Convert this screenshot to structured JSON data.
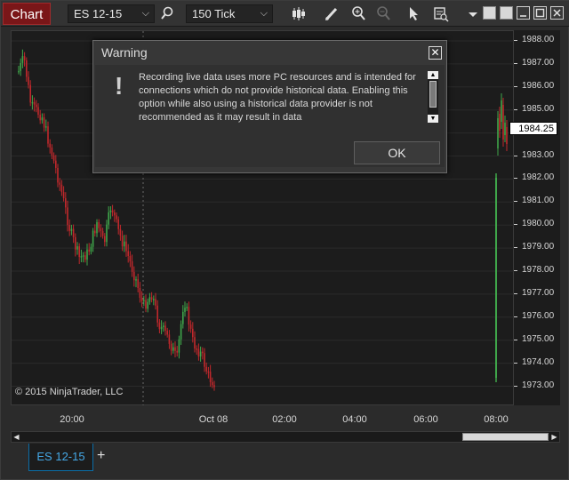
{
  "toolbar": {
    "chart_label": "Chart",
    "instrument": "ES 12-15",
    "interval": "150 Tick",
    "icons": [
      "search-icon",
      "bar-type-icon",
      "pencil-icon",
      "zoom-in-icon",
      "zoom-out-icon",
      "cursor-icon",
      "data-box-icon",
      "dropdown-icon",
      "tile-icon",
      "tile-icon",
      "minimize-icon",
      "maximize-icon",
      "close-icon"
    ]
  },
  "price_axis": {
    "labels": [
      "1988.00",
      "1987.00",
      "1986.00",
      "1985.00",
      "1984.00",
      "1983.00",
      "1982.00",
      "1981.00",
      "1980.00",
      "1979.00",
      "1978.00",
      "1977.00",
      "1976.00",
      "1975.00",
      "1974.00",
      "1973.00"
    ],
    "last_price": "1984.25"
  },
  "time_axis": {
    "labels": [
      "20:00",
      "Oct 08",
      "02:00",
      "04:00",
      "06:00",
      "08:00"
    ]
  },
  "copyright": "© 2015 NinjaTrader, LLC",
  "dialog": {
    "title": "Warning",
    "close_label": "✕",
    "icon_glyph": "!",
    "message": "Recording live data uses more PC resources and is intended for connections which do not provide historical data.  Enabling this option while also using a historical data provider is not recommended as it may result in data",
    "ok_label": "OK"
  },
  "tabs": [
    {
      "label": "ES 12-15"
    }
  ],
  "add_tab_label": "+",
  "colors": {
    "up_candle": "#3fa64a",
    "down_candle": "#c0282c",
    "chart_bg": "#1c1c1c",
    "accent": "#45a8e6"
  }
}
